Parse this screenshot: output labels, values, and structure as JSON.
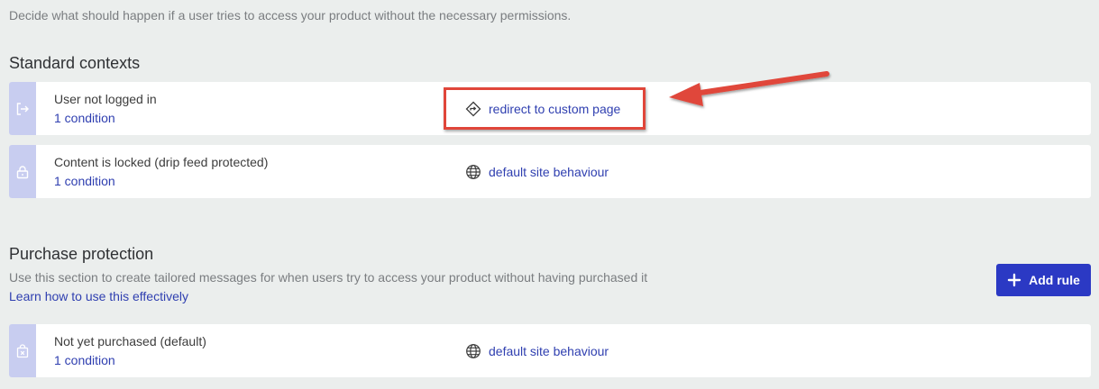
{
  "intro_text": "Decide what should happen if a user tries to access your product without the necessary permissions.",
  "standard": {
    "title": "Standard contexts",
    "rows": [
      {
        "label": "User not logged in",
        "condition": "1 condition",
        "action": "redirect to custom page",
        "icon": "logout-icon",
        "action_icon": "diamond-arrow-icon"
      },
      {
        "label": "Content is locked (drip feed protected)",
        "condition": "1 condition",
        "action": "default site behaviour",
        "icon": "lock-icon",
        "action_icon": "globe-icon"
      }
    ]
  },
  "purchase": {
    "title": "Purchase protection",
    "description": "Use this section to create tailored messages for when users try to access your product without having purchased it",
    "learn_link": "Learn how to use this effectively",
    "add_rule_label": "Add rule",
    "rows": [
      {
        "label": "Not yet purchased (default)",
        "condition": "1 condition",
        "action": "default site behaviour",
        "icon": "shopping-bag-icon",
        "action_icon": "globe-icon"
      }
    ]
  },
  "colors": {
    "background": "#ebeeed",
    "accent": "#2b39c4",
    "link": "#2f3fb0",
    "strip": "#c8cdf0",
    "annotation": "#e0463a"
  }
}
